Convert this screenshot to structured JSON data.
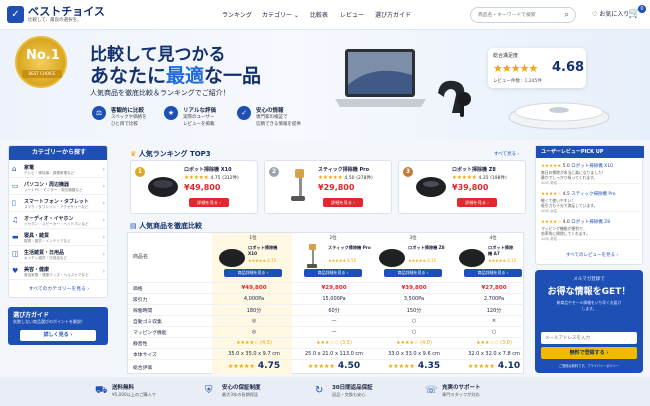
{
  "header": {
    "logo_icon": "check-badge-icon",
    "site_name": "ベストチョイス",
    "tagline": "比較して、最良の選択を。",
    "nav": [
      "ランキング",
      "カテゴリー ⌄",
      "比較表",
      "レビュー",
      "選び方ガイド"
    ],
    "search_placeholder": "商品名・キーワードで検索",
    "favorites": "お気に入り",
    "cart_count": "0"
  },
  "hero": {
    "badge_no1": "No.1",
    "badge_text": "BEST CHOICE",
    "title_line1": "比較して見つかる",
    "title_line2_a": "あなたに",
    "title_line2_em": "最適",
    "title_line2_b": "な一品",
    "subtitle": "人気商品を徹底比較＆ランキングでご紹介！",
    "features": [
      {
        "icon": "scale-icon",
        "title": "客観的に比較",
        "desc1": "スペックや価格を",
        "desc2": "ひと目で比較"
      },
      {
        "icon": "star-icon",
        "title": "リアルな評価",
        "desc1": "実際のユーザー",
        "desc2": "レビューを掲載"
      },
      {
        "icon": "shield-icon",
        "title": "安心の情報",
        "desc1": "専門家の検証で",
        "desc2": "信頼できる情報を提供"
      }
    ],
    "rating_card": {
      "label": "総合満足度",
      "stars": "★★★★★",
      "score": "4.68",
      "count": "レビュー件数：1,245件"
    }
  },
  "sidebar": {
    "title": "カテゴリーから探す",
    "items": [
      {
        "icon": "home-icon",
        "name": "家電",
        "desc": "テレビ・掃除機・調理家電など"
      },
      {
        "icon": "monitor-icon",
        "name": "パソコン・周辺機器",
        "desc": "ノートPC・モニター・周辺機器など"
      },
      {
        "icon": "phone-icon",
        "name": "スマートフォン・タブレット",
        "desc": "スマホ・タブレット・アクセサリーなど"
      },
      {
        "icon": "headphones-icon",
        "name": "オーディオ・イヤホン",
        "desc": "イヤホン・スピーカー・ヘッドホンなど"
      },
      {
        "icon": "bed-icon",
        "name": "寝具・雑貨",
        "desc": "寝具・雑貨・インテリアなど"
      },
      {
        "icon": "cart-icon",
        "name": "生活雑貨・日用品",
        "desc": "キッチン雑貨・日用品など"
      },
      {
        "icon": "heart-icon",
        "name": "美容・健康",
        "desc": "美容家電・健康グッズ・ヘルスケアなど"
      }
    ],
    "view_all": "すべてのカテゴリーを見る ›"
  },
  "guide": {
    "title": "選び方ガイド",
    "desc": "失敗しない商品選びのポイントを解説！",
    "button": "詳しく見る ›"
  },
  "ranking": {
    "title": "人気ランキング TOP3",
    "link": "すべて見る ›",
    "items": [
      {
        "rank": "1",
        "name": "ロボット掃除機 X10",
        "stars": "★★★★★",
        "score": "4.75",
        "count": "(312件)",
        "price": "¥49,800",
        "button": "詳細を見る ›"
      },
      {
        "rank": "2",
        "name": "スティック掃除機 Pro",
        "stars": "★★★★★",
        "score": "4.50",
        "count": "(278件)",
        "price": "¥29,800",
        "button": "詳細を見る ›"
      },
      {
        "rank": "3",
        "name": "ロボット掃除機 Z8",
        "stars": "★★★★★",
        "score": "4.35",
        "count": "(198件)",
        "price": "¥39,800",
        "button": "詳細を見る ›"
      }
    ]
  },
  "compare": {
    "title": "人気商品を徹底比較",
    "product_label": "商品名",
    "columns": [
      {
        "rank": "1位",
        "name1": "ロボット掃除機",
        "name2": "X10",
        "stars": "★★★★★",
        "score": "4.75",
        "button": "商品詳細を見る ›"
      },
      {
        "rank": "2位",
        "name1": "スティック掃除機 Pro",
        "name2": "",
        "stars": "★★★★★",
        "score": "4.50",
        "button": "商品詳細を見る ›"
      },
      {
        "rank": "3位",
        "name1": "ロボット掃除機 Z8",
        "name2": "",
        "stars": "★★★★★",
        "score": "4.35",
        "button": "商品詳細を見る ›"
      },
      {
        "rank": "4位",
        "name1": "ロボット掃除",
        "name2": "機 A7",
        "stars": "★★★★★",
        "score": "4.10",
        "button": "商品詳細を見る ›"
      }
    ],
    "rows": [
      {
        "label": "価格",
        "values": [
          "¥49,800",
          "¥29,800",
          "¥39,800",
          "¥27,800"
        ]
      },
      {
        "label": "吸引力",
        "values": [
          "4,000Pa",
          "15,000Pa",
          "3,500Pa",
          "2,700Pa"
        ]
      },
      {
        "label": "稼働時間",
        "values": [
          "180分",
          "60分",
          "150分",
          "120分"
        ]
      },
      {
        "label": "自動ゴミ収集",
        "values": [
          "◎",
          "—",
          "○",
          "×"
        ]
      },
      {
        "label": "マッピング機能",
        "values": [
          "◎",
          "—",
          "○",
          "○"
        ]
      },
      {
        "label": "静音性",
        "values": [
          "★★★★☆ (4.5)",
          "★★★☆☆ (3.5)",
          "★★★★☆ (4.0)",
          "★★★☆☆ (3.0)"
        ]
      },
      {
        "label": "本体サイズ",
        "values": [
          "35.0 x 35.0 x 9.7 cm",
          "25.0 x 21.0 x 113.0 cm",
          "33.0 x 33.0 x 9.6 cm",
          "32.0 x 32.0 x 7.8 cm"
        ]
      },
      {
        "label": "総合評価",
        "values": [
          "4.75",
          "4.50",
          "4.35",
          "4.10"
        ],
        "stars": "★★★★★"
      }
    ]
  },
  "reviews": {
    "title": "ユーザーレビューPICK UP",
    "items": [
      {
        "stars": "★★★★★",
        "score": "5.0",
        "product": "ロボット掃除機 X10",
        "text1": "毎日の掃除が本当に楽になりました！",
        "text2": "静かでしっかり吸ってくれます。",
        "meta": "30代 男性"
      },
      {
        "stars": "★★★★☆",
        "score": "4.5",
        "product": "スティック掃除機 Pro",
        "text1": "軽くて使いやすい！",
        "text2": "吸引力も十分で満足しています。",
        "meta": "40代 女性"
      },
      {
        "stars": "★★★★☆",
        "score": "4.0",
        "product": "ロボット掃除機 Z8",
        "text1": "マッピング機能が便利で、",
        "text2": "効率的に掃除してくれます。",
        "meta": "20代 男性"
      }
    ],
    "view_all": "すべてのレビューを見る ›"
  },
  "newsletter": {
    "subtitle": "メルマガ登録で",
    "title": "お得な情報をGET！",
    "desc1": "新商品やセール情報をいち早くお届け",
    "desc2": "します。",
    "placeholder": "メールアドレスを入力",
    "button": "無料で登録する ›",
    "note": "ご登録は無料です。プライバシーポリシー"
  },
  "benefits": [
    {
      "icon": "truck-icon",
      "title": "送料無料",
      "desc": "¥5,000以上のご購入で"
    },
    {
      "icon": "shield-icon",
      "title": "安心の保証制度",
      "desc": "最大3年の長期保証"
    },
    {
      "icon": "refresh-icon",
      "title": "30日間返品保証",
      "desc": "返品・交換も安心"
    },
    {
      "icon": "headset-icon",
      "title": "充実のサポート",
      "desc": "専門スタッフが対応"
    }
  ],
  "colors": {
    "primary": "#1e4fb5",
    "accent_red": "#e0282e",
    "star": "#f0a500",
    "highlight": "#fff8e3"
  }
}
